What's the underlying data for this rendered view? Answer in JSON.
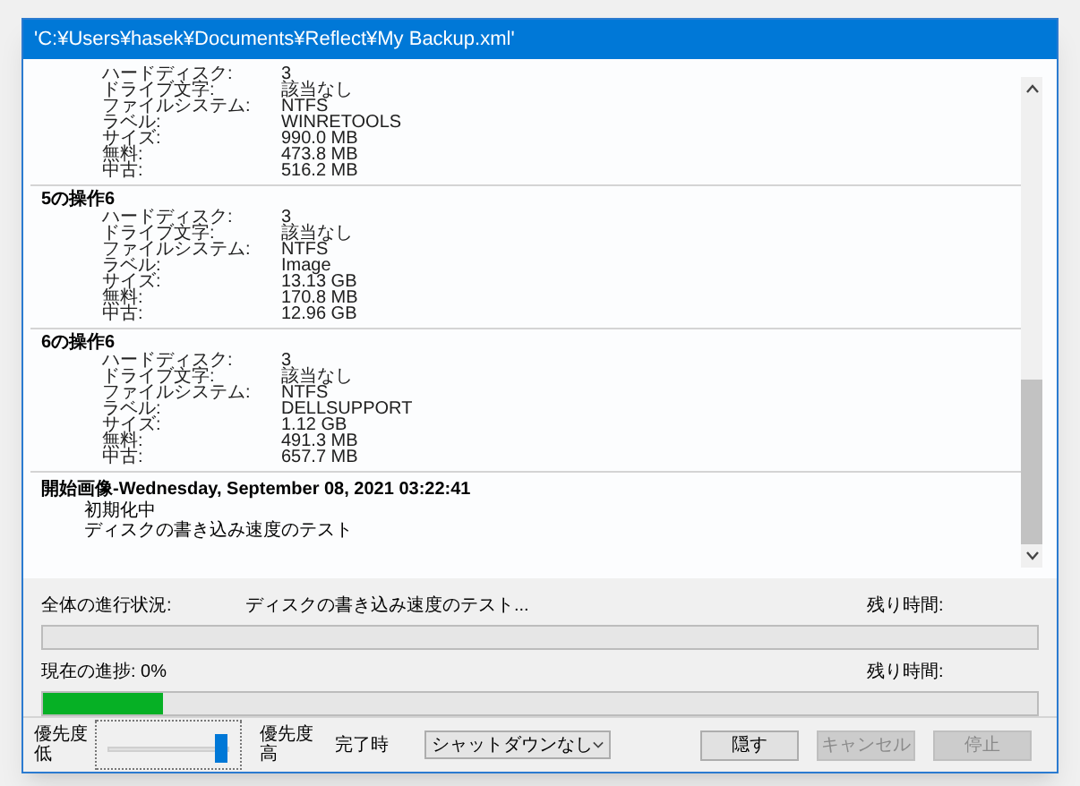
{
  "window": {
    "title": "'C:¥Users¥hasek¥Documents¥Reflect¥My Backup.xml'"
  },
  "log": {
    "sections": [
      {
        "rows": [
          {
            "label": "ハードディスク:",
            "value": "3"
          },
          {
            "label": "ドライブ文字:",
            "value": "該当なし"
          },
          {
            "label": "ファイルシステム:",
            "value": "NTFS"
          },
          {
            "label": "ラベル:",
            "value": "WINRETOOLS"
          },
          {
            "label": "サイズ:",
            "value": "990.0 MB"
          },
          {
            "label": "無料:",
            "value": "473.8 MB"
          },
          {
            "label": "中古:",
            "value": "516.2 MB"
          }
        ]
      },
      {
        "heading": "5の操作6",
        "rows": [
          {
            "label": "ハードディスク:",
            "value": "3"
          },
          {
            "label": "ドライブ文字:",
            "value": "該当なし"
          },
          {
            "label": "ファイルシステム:",
            "value": "NTFS"
          },
          {
            "label": "ラベル:",
            "value": "Image"
          },
          {
            "label": "サイズ:",
            "value": "13.13 GB"
          },
          {
            "label": "無料:",
            "value": "170.8 MB"
          },
          {
            "label": "中古:",
            "value": "12.96 GB"
          }
        ]
      },
      {
        "heading": "6の操作6",
        "rows": [
          {
            "label": "ハードディスク:",
            "value": "3"
          },
          {
            "label": "ドライブ文字:",
            "value": "該当なし"
          },
          {
            "label": "ファイルシステム:",
            "value": "NTFS"
          },
          {
            "label": "ラベル:",
            "value": "DELLSUPPORT"
          },
          {
            "label": "サイズ:",
            "value": "1.12 GB"
          },
          {
            "label": "無料:",
            "value": "491.3 MB"
          },
          {
            "label": "中古:",
            "value": "657.7 MB"
          }
        ]
      }
    ],
    "footer": {
      "heading": "開始画像-Wednesday, September 08, 2021 03:22:41",
      "lines": [
        "初期化中",
        "ディスクの書き込み速度のテスト"
      ]
    }
  },
  "overall_progress": {
    "label": "全体の進行状況:",
    "status": "ディスクの書き込み速度のテスト...",
    "remaining": "残り時間:",
    "level": 0
  },
  "current_progress": {
    "label": "現在の進捗: 0%",
    "remaining": "残り時間:",
    "level": 0.12
  },
  "bottom": {
    "priority_low": [
      "優先度",
      "低"
    ],
    "priority_slider": {
      "level": 1
    },
    "priority_high": [
      "優先度",
      "高"
    ],
    "on_complete": "完了時",
    "shutdown_select": "シャットダウンなし",
    "buttons": [
      {
        "label": "隠す",
        "disabled": false
      },
      {
        "label": "キャンセル",
        "disabled": true
      },
      {
        "label": "停止",
        "disabled": true
      }
    ]
  }
}
